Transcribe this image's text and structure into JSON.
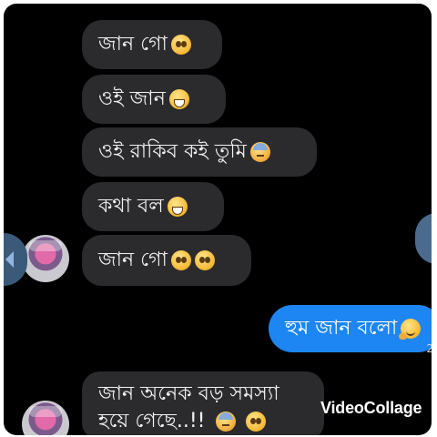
{
  "conversation": {
    "incoming": [
      {
        "text": "জান গো",
        "emojis": [
          "pleading-face"
        ]
      },
      {
        "text": "ওই জান ",
        "emojis": [
          "grinning-face"
        ]
      },
      {
        "text": "ওই রাকিব কই তুমি ",
        "emojis": [
          "downcast-sweat-face"
        ]
      },
      {
        "text": "কথা বল ",
        "emojis": [
          "grinning-face"
        ]
      },
      {
        "text": "জান গো ",
        "emojis": [
          "pleading-face",
          "pleading-face"
        ]
      },
      {
        "text_line1": "জান অনেক বড় সমস্যা",
        "text_line2": "হয়ে গেছে..!!",
        "emojis": [
          "downcast-sweat-face",
          "pleading-face"
        ]
      }
    ],
    "outgoing": [
      {
        "text": "হুম জান বলো",
        "emojis": [
          "hugging-face"
        ]
      }
    ],
    "timestamp_partial": "2"
  },
  "watermark": "VideoCollage",
  "colors": {
    "background": "#000000",
    "incoming_bubble": "#2b2b2e",
    "outgoing_bubble": "#1d86f2",
    "text": "#f2f2f2"
  }
}
